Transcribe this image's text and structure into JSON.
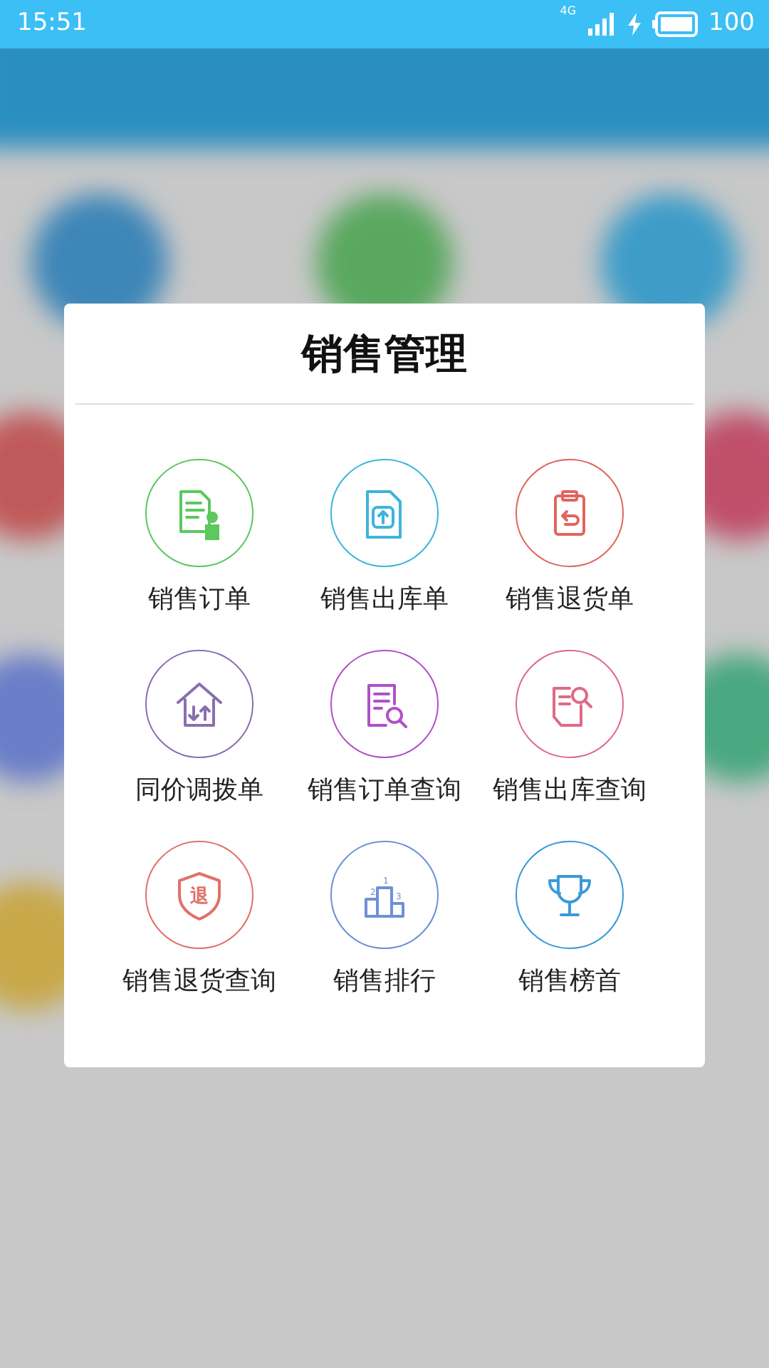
{
  "status_bar": {
    "time": "15:51",
    "network": "4G",
    "battery": "100"
  },
  "dialog": {
    "title": "销售管理",
    "items": [
      {
        "label": "销售订单",
        "kind": "doc-user",
        "color": "#5cc85e"
      },
      {
        "label": "销售出库单",
        "kind": "doc-upload",
        "color": "#3db4dc"
      },
      {
        "label": "销售退货单",
        "kind": "clipboard-return",
        "color": "#e0665e"
      },
      {
        "label": "同价调拨单",
        "kind": "house-swap",
        "color": "#8a6fb0"
      },
      {
        "label": "销售订单查询",
        "kind": "doc-search",
        "color": "#b050c8"
      },
      {
        "label": "销售出库查询",
        "kind": "page-search",
        "color": "#e06a86"
      },
      {
        "label": "销售退货查询",
        "kind": "shield",
        "color": "#e0726a",
        "icon_text": "退"
      },
      {
        "label": "销售排行",
        "kind": "podium",
        "color": "#6f8fd8",
        "icon_labels": [
          "2",
          "1",
          "3"
        ]
      },
      {
        "label": "销售榜首",
        "kind": "trophy",
        "color": "#3a9ad8"
      }
    ]
  }
}
